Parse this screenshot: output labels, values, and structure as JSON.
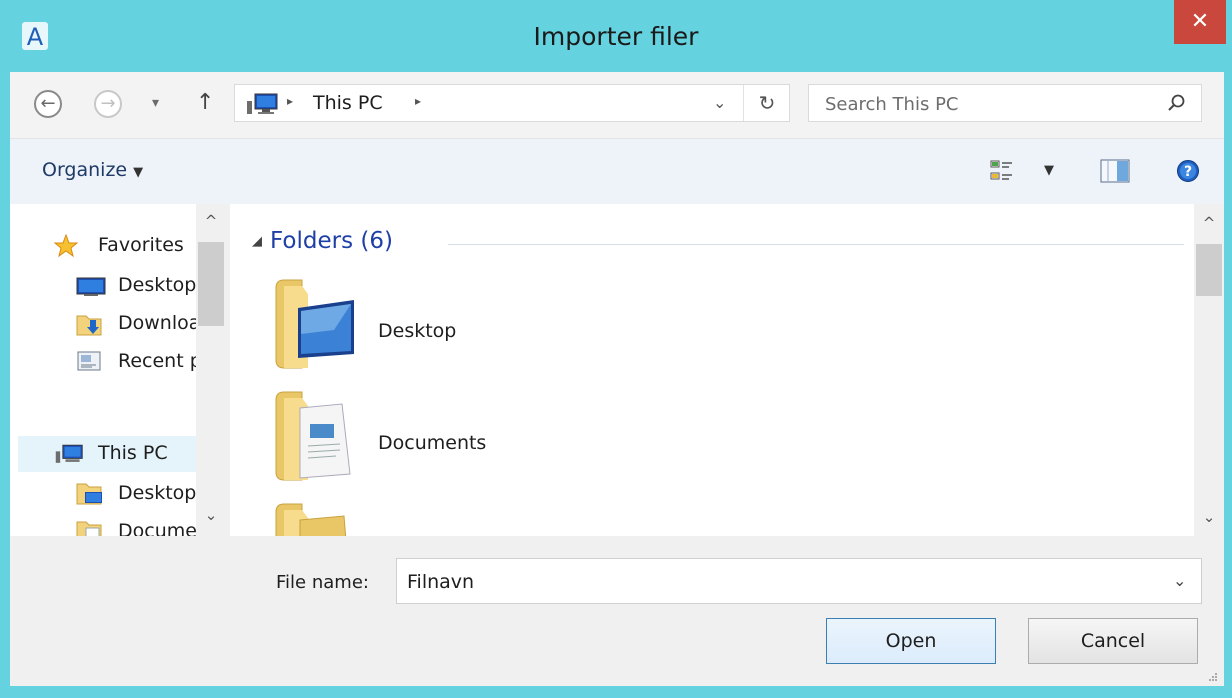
{
  "window": {
    "title": "Importer filer",
    "app_icon_letter": "A",
    "close_glyph": "✕"
  },
  "nav": {
    "back_glyph": "←",
    "forward_glyph": "→",
    "recent_glyph": "▾",
    "up_glyph": "↑",
    "address": {
      "icon": "this-pc-icon",
      "crumbs": [
        "This PC"
      ],
      "separator": "▸",
      "dropdown_glyph": "⌄",
      "refresh_glyph": "↻"
    },
    "search": {
      "placeholder": "Search This PC",
      "value": ""
    }
  },
  "toolbar": {
    "organize_label": "Organize",
    "organize_arrow": "▼",
    "views_arrow": "▼"
  },
  "sidebar": {
    "items": [
      {
        "label": "Favorites",
        "icon": "star-icon"
      },
      {
        "label": "Desktop",
        "icon": "desktop-icon"
      },
      {
        "label": "Downloads",
        "icon": "downloads-icon"
      },
      {
        "label": "Recent places",
        "icon": "recent-places-icon"
      },
      {
        "label": "This PC",
        "icon": "this-pc-icon"
      },
      {
        "label": "Desktop",
        "icon": "desktop-folder-icon"
      },
      {
        "label": "Documents",
        "icon": "documents-folder-icon"
      }
    ],
    "scroll_up": "^",
    "scroll_down": "⌄"
  },
  "content": {
    "group_toggle": "◢",
    "group_header": "Folders (6)",
    "folders": [
      {
        "name": "Desktop",
        "icon": "desktop-folder-icon"
      },
      {
        "name": "Documents",
        "icon": "documents-folder-icon"
      },
      {
        "name": "",
        "icon": "folder-icon"
      }
    ],
    "scroll_up": "^",
    "scroll_down": "⌄"
  },
  "bottom": {
    "file_name_label": "File name:",
    "file_name_value": "Filnavn",
    "file_name_dropdown": "⌄",
    "open_label": "Open",
    "cancel_label": "Cancel"
  },
  "colors": {
    "title_bar": "#65d2df",
    "close_button": "#c9473d",
    "link_blue": "#1e3fa6"
  }
}
